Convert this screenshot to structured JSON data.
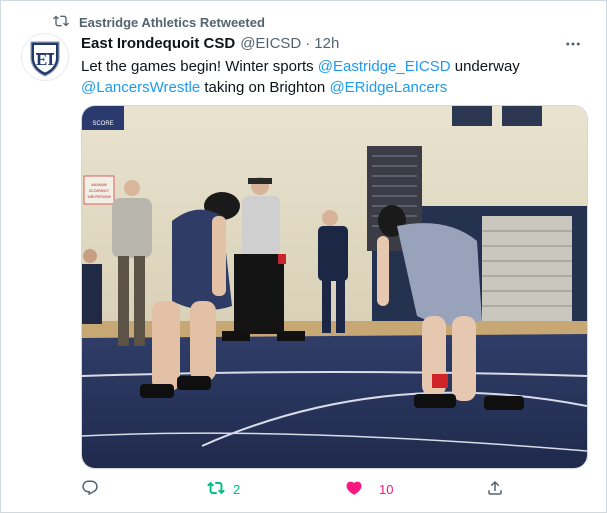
{
  "retweet_context": {
    "label": "Eastridge Athletics Retweeted",
    "icon": "retweet-icon"
  },
  "tweet": {
    "author_name": "East Irondequoit CSD",
    "handle": "@EICSD",
    "separator": "·",
    "time": "12h",
    "avatar_letters": "EI",
    "text": {
      "part1": "Let the games begin! Winter sports ",
      "mention1": "@Eastridge_EICSD",
      "part2": " underway ",
      "mention2": "@LancersWrestle",
      "part3": " taking on Brighton ",
      "mention3": "@ERidgeLancers"
    },
    "media": {
      "description_icon": "photo",
      "sign_occupancy": "MAXIMUM OCCUPANCY NOT TO EXCEED 1450 PERSONS",
      "sign_score": "SCORE"
    }
  },
  "actions": {
    "reply": {
      "icon": "reply-icon",
      "count": ""
    },
    "retweet": {
      "icon": "retweet-icon",
      "count": "2",
      "color": "#00ba7c"
    },
    "like": {
      "icon": "heart-filled-icon",
      "count": "10",
      "color": "#f91880"
    },
    "share": {
      "icon": "share-icon",
      "count": ""
    }
  },
  "colors": {
    "accent": "#1d9bf0",
    "secondary_text": "#536471",
    "mat_blue": "#2b3a66"
  }
}
